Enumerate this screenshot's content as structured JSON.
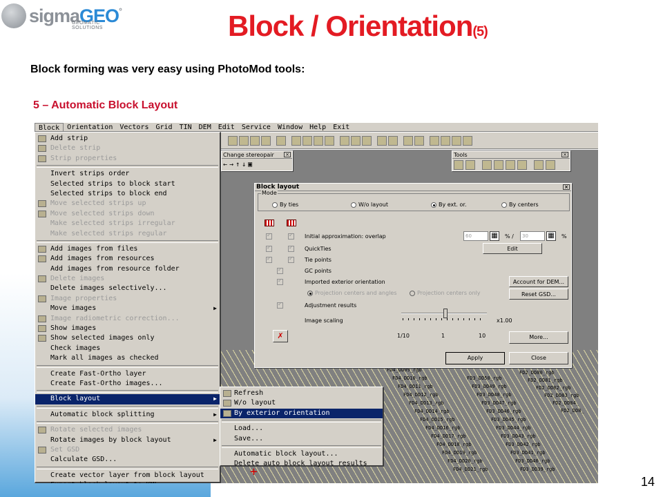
{
  "slide": {
    "logo": {
      "word_a": "sigma",
      "word_b": "GEO",
      "mark": "°",
      "tagline": "GEOMATIC SOLUTIONS"
    },
    "title": "Block / Orientation",
    "title_suffix": "(5)",
    "subtitle": "Block forming was very easy using PhotoMod tools:",
    "step": "5 – Automatic Block Layout",
    "page_number": "14"
  },
  "app": {
    "menubar": [
      "Block",
      "Orientation",
      "Vectors",
      "Grid",
      "TIN",
      "DEM",
      "Edit",
      "Service",
      "Window",
      "Help",
      "Exit"
    ],
    "block_menu": [
      {
        "label": "Add strip",
        "disabled": false,
        "icon": "add-strip-icon"
      },
      {
        "label": "Delete strip",
        "disabled": true,
        "icon": "delete-strip-icon"
      },
      {
        "label": "Strip properties",
        "disabled": true,
        "icon": "strip-properties-icon"
      },
      {
        "sep": true
      },
      {
        "label": "Invert strips order",
        "disabled": false
      },
      {
        "label": "Selected strips to block start",
        "disabled": false
      },
      {
        "label": "Selected strips to block end",
        "disabled": false
      },
      {
        "label": "Move selected strips up",
        "disabled": true,
        "icon": "arrow-up-icon"
      },
      {
        "label": "Move selected strips down",
        "disabled": true,
        "icon": "arrow-down-icon"
      },
      {
        "label": "Make selected strips irregular",
        "disabled": true
      },
      {
        "label": "Make selected strips regular",
        "disabled": true
      },
      {
        "sep": true
      },
      {
        "label": "Add images from files",
        "disabled": false,
        "icon": "add-images-icon"
      },
      {
        "label": "Add images from resources",
        "disabled": false,
        "icon": "add-resources-icon"
      },
      {
        "label": "Add images from resource folder",
        "disabled": false
      },
      {
        "label": "Delete images",
        "disabled": true,
        "icon": "delete-images-icon"
      },
      {
        "label": "Delete images selectively...",
        "disabled": false
      },
      {
        "label": "Image properties",
        "disabled": true,
        "icon": "image-properties-icon"
      },
      {
        "label": "Move images",
        "disabled": false,
        "submenu": true
      },
      {
        "label": "Image radiometric correction...",
        "disabled": true,
        "icon": "radiometric-icon"
      },
      {
        "label": "Show images",
        "disabled": false,
        "icon": "show-images-icon"
      },
      {
        "label": "Show selected images only",
        "disabled": false,
        "icon": "show-selected-icon"
      },
      {
        "label": "Check images",
        "disabled": false
      },
      {
        "label": "Mark all images as checked",
        "disabled": false
      },
      {
        "sep": true
      },
      {
        "label": "Create Fast-Ortho layer",
        "disabled": false
      },
      {
        "label": "Create Fast-Ortho images...",
        "disabled": false
      },
      {
        "sep": true
      },
      {
        "label": "Block layout",
        "disabled": false,
        "submenu": true,
        "selected": true
      },
      {
        "sep": true
      },
      {
        "label": "Automatic block splitting",
        "disabled": false,
        "submenu": true
      },
      {
        "sep": true
      },
      {
        "label": "Rotate selected images",
        "disabled": true,
        "icon": "rotate-icon"
      },
      {
        "label": "Rotate images by block layout",
        "disabled": false,
        "submenu": true
      },
      {
        "label": "Set GSD",
        "disabled": true,
        "icon": "gsd-icon"
      },
      {
        "label": "Calculate GSD...",
        "disabled": false
      },
      {
        "sep": true
      },
      {
        "label": "Create vector layer from block layout",
        "disabled": false
      },
      {
        "label": "Export block layout to KML...",
        "disabled": false
      }
    ],
    "submenu": [
      {
        "label": "Refresh",
        "icon": "refresh-icon"
      },
      {
        "label": "W/o layout",
        "icon": "grid-icon"
      },
      {
        "label": "By exterior orientation",
        "icon": "grid-icon",
        "selected": true
      },
      {
        "sep": true
      },
      {
        "label": "Load..."
      },
      {
        "label": "Save..."
      },
      {
        "sep": true
      },
      {
        "label": "Automatic block layout..."
      },
      {
        "label": "Delete auto block layout results"
      }
    ],
    "panels": {
      "stereo_title": "Change stereopair",
      "tools_title": "Tools"
    },
    "dialog": {
      "title": "Block layout",
      "mode_label": "Mode",
      "modes": [
        "By ties",
        "W/o layout",
        "By ext. or.",
        "By centers"
      ],
      "selected_mode": "By ext. or.",
      "options": {
        "initial_approx": "Initial approximation: overlap",
        "quickties": "QuickTies",
        "tie_points": "Tie points",
        "gc_points": "GC points",
        "imported_eo": "Imported exterior orientation",
        "proj_centers_angles": "Projection centers and angles",
        "proj_centers_only": "Projection centers only",
        "adjustment": "Adjustment results",
        "image_scaling": "Image scaling"
      },
      "overlap_1": "60",
      "overlap_2": "30",
      "pct_1": "% /",
      "pct_2": "%",
      "scale_ticks": [
        "1/10",
        "1",
        "10"
      ],
      "scale_value": "x1.00",
      "slider_level": 0.52,
      "buttons": {
        "edit": "Edit",
        "account_dem": "Account for DEM...",
        "reset_gsd": "Reset GSD...",
        "more": "More...",
        "apply": "Apply",
        "close": "Close"
      }
    },
    "frame_labels": [
      "FD4_DD09_rgb",
      "FD4_DD10_rgb",
      "FD4_DD11_rgb",
      "FD4_DD12_rgb",
      "FD4_DD13_rgb",
      "FD4_DD14_rgb",
      "FD4_DD15_rgb",
      "FD4_DD16_rgb",
      "FD4_DD17_rgb",
      "FD4_DD18_rgb",
      "FD4_DD19_rgb",
      "FD4_DD20_rgb",
      "FD4_DD21_rgb",
      "FD3_DD50_rgb",
      "FD3_DD49_rgb",
      "FD3_DD48_rgb",
      "FD3_DD47_rgb",
      "FD3_DD46_rgb",
      "FD3_DD45_rgb",
      "FD3_DD44_rgb",
      "FD3_DD43_rgb",
      "FD3_DD42_rgb",
      "FD3_DD41_rgb",
      "FD3_DD40_rgb",
      "FD3_DD39_rgb",
      "FD2_DD80_rgb",
      "FD2_DD81_rgb",
      "FD2_DD82_rgb",
      "FD2_DD83_rgb",
      "FD2_DD84_",
      "FD2_DD8_"
    ]
  }
}
